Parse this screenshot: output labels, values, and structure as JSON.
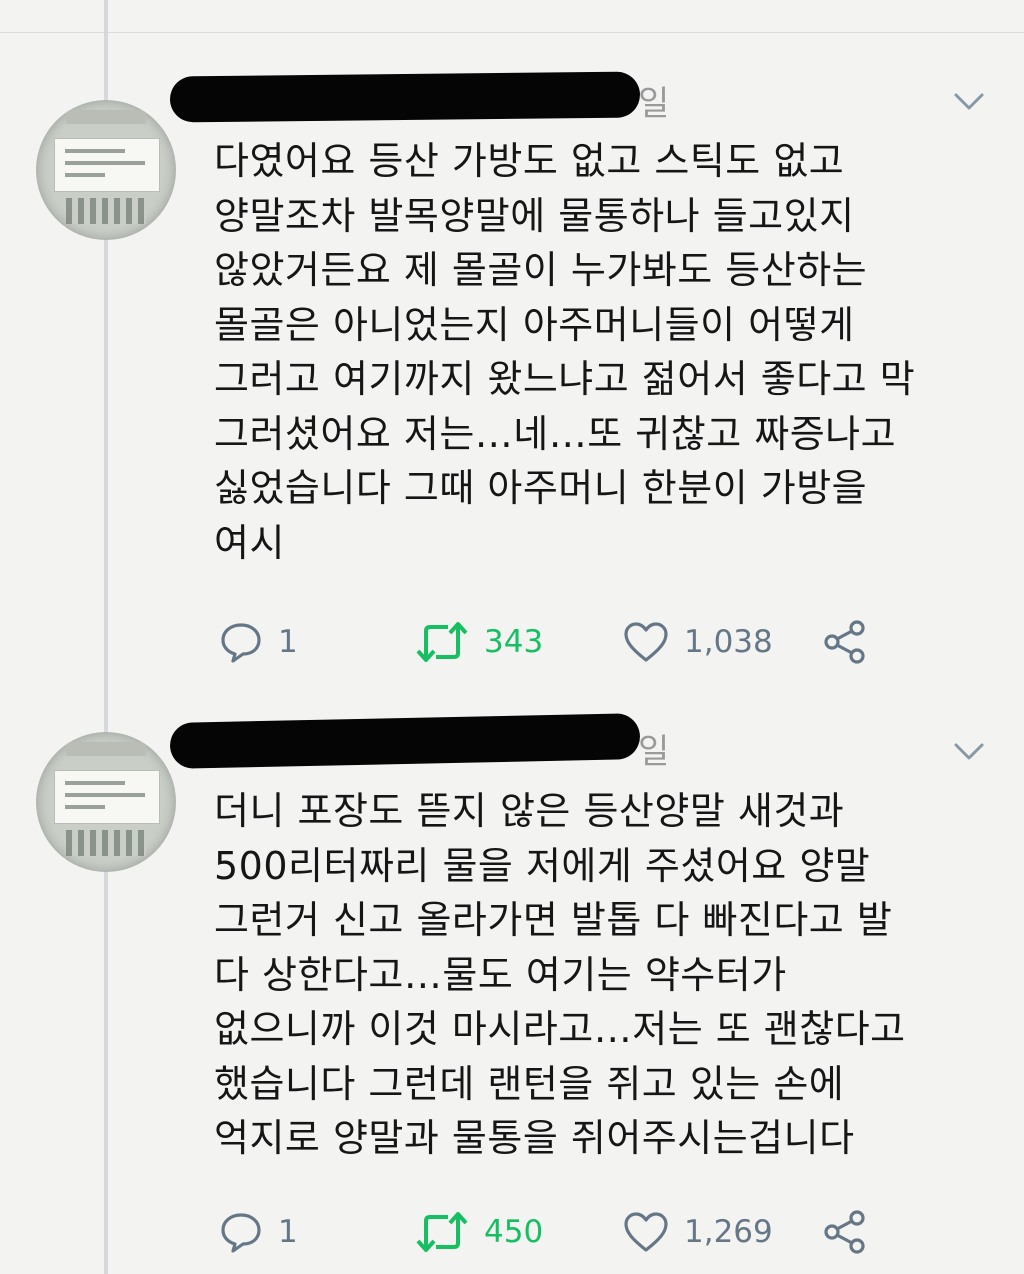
{
  "colors": {
    "background": "#f3f4f2",
    "retweet_active": "#17bf63",
    "action_gray": "#657786",
    "redaction": "#050505"
  },
  "tweets": [
    {
      "date_suffix": "일",
      "text": "다였어요 등산 가방도 없고 스틱도 없고\n양말조차 발목양말에 물통하나 들고있지\n않았거든요 제 몰골이 누가봐도 등산하는\n몰골은 아니었는지 아주머니들이 어떻게\n그러고 여기까지 왔느냐고 젊어서 좋다고 막\n그러셨어요 저는…네…또 귀찮고 짜증나고\n싫었습니다 그때 아주머니 한분이 가방을\n여시",
      "replies": "1",
      "retweets": "343",
      "likes": "1,038"
    },
    {
      "date_suffix": "일",
      "text": "더니 포장도 뜯지 않은 등산양말 새것과\n500리터짜리 물을 저에게 주셨어요 양말\n그런거 신고 올라가면 발톱 다 빠진다고 발\n다 상한다고…물도 여기는 약수터가\n없으니까 이것 마시라고…저는 또 괜찮다고\n했습니다 그런데 랜턴을 쥐고 있는 손에\n억지로 양말과 물통을 쥐어주시는겁니다",
      "replies": "1",
      "retweets": "450",
      "likes": "1,269"
    }
  ],
  "icons": {
    "reply": "reply-icon",
    "retweet": "retweet-icon",
    "like": "heart-icon",
    "share": "share-icon",
    "menu": "chevron-down-icon"
  }
}
